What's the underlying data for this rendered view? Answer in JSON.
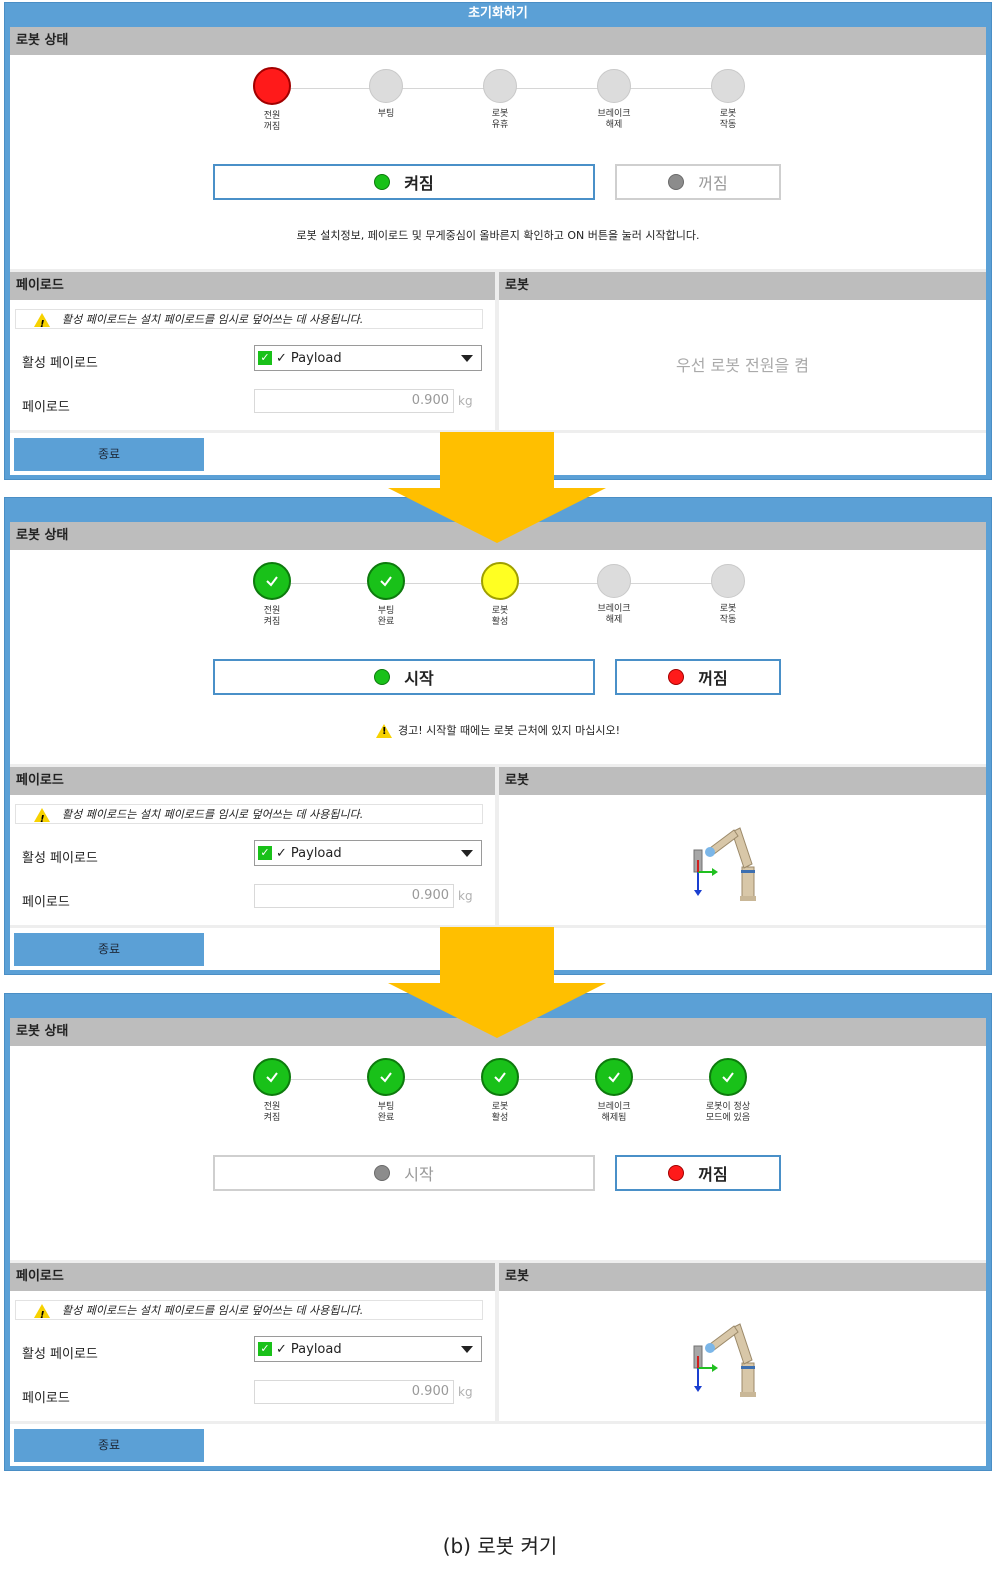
{
  "window_title": "초기화하기",
  "section_status_title": "로봇 상태",
  "section_payload_title": "페이로드",
  "section_robot_title": "로봇",
  "payload": {
    "note": "활성 페이로드는 설치 페이로드를 임시로 덮어쓰는 데 사용됩니다.",
    "active_label": "활성 페이로드",
    "payload_label": "페이로드",
    "selected": "Payload",
    "value": "0.900",
    "unit": "kg"
  },
  "exit_label": "종료",
  "panels": [
    {
      "steps": [
        {
          "label": "전원\n꺼짐",
          "state": "red"
        },
        {
          "label": "부팅",
          "state": "grey"
        },
        {
          "label": "로봇\n유휴",
          "state": "grey"
        },
        {
          "label": "브레이크\n해제",
          "state": "grey"
        },
        {
          "label": "로봇\n작동",
          "state": "grey"
        }
      ],
      "left_button": {
        "label": "켜짐",
        "dot": "green",
        "active": true
      },
      "right_button": {
        "label": "꺼짐",
        "dot": "grey",
        "active": false
      },
      "message": "로봇 설치정보, 페이로드 및 무게중심이 올바른지 확인하고 ON 버튼을 눌러 시작합니다.",
      "message_warning": false,
      "robot_text": "우선 로봇 전원을 켬",
      "show_robot": false
    },
    {
      "steps": [
        {
          "label": "전원\n켜짐",
          "state": "green"
        },
        {
          "label": "부팅\n완료",
          "state": "green"
        },
        {
          "label": "로봇\n활성",
          "state": "yellow"
        },
        {
          "label": "브레이크\n해제",
          "state": "grey"
        },
        {
          "label": "로봇\n작동",
          "state": "grey"
        }
      ],
      "left_button": {
        "label": "시작",
        "dot": "green",
        "active": true
      },
      "right_button": {
        "label": "꺼짐",
        "dot": "red",
        "active": true
      },
      "message": "경고! 시작할 때에는 로봇 근처에 있지 마십시오!",
      "message_warning": true,
      "robot_text": "",
      "show_robot": true
    },
    {
      "steps": [
        {
          "label": "전원\n켜짐",
          "state": "green"
        },
        {
          "label": "부팅\n완료",
          "state": "green"
        },
        {
          "label": "로봇\n활성",
          "state": "green"
        },
        {
          "label": "브레이크\n해제됨",
          "state": "green"
        },
        {
          "label": "로봇이 정상\n모드에 있음",
          "state": "green"
        }
      ],
      "left_button": {
        "label": "시작",
        "dot": "grey",
        "active": false
      },
      "right_button": {
        "label": "꺼짐",
        "dot": "red",
        "active": true
      },
      "message": "",
      "message_warning": false,
      "robot_text": "",
      "show_robot": true
    }
  ],
  "caption": "(b) 로봇 켜기",
  "colors": {
    "accent_blue": "#5ba0d6",
    "step_red": "#ff1a1a",
    "step_green": "#19c119",
    "step_yellow": "#ffff22",
    "arrow_yellow": "#ffbf00"
  }
}
